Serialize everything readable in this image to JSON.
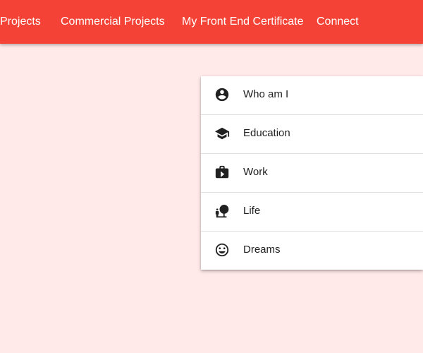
{
  "nav": {
    "items": [
      {
        "label": "Projects"
      },
      {
        "label": "Commercial Projects"
      },
      {
        "label": "My Front End Certificate"
      },
      {
        "label": "Connect"
      }
    ]
  },
  "menu": {
    "items": [
      {
        "label": "Who am I",
        "icon": "account-circle-icon"
      },
      {
        "label": "Education",
        "icon": "school-icon"
      },
      {
        "label": "Work",
        "icon": "briefcase-icon"
      },
      {
        "label": "Life",
        "icon": "nature-people-icon"
      },
      {
        "label": "Dreams",
        "icon": "smiley-face-icon"
      }
    ]
  },
  "colors": {
    "toolbar": "#f44336",
    "background": "#ffe9e9",
    "menu_bg": "#ffffff",
    "text_dark": "#212121",
    "nav_text": "#ffffff"
  }
}
